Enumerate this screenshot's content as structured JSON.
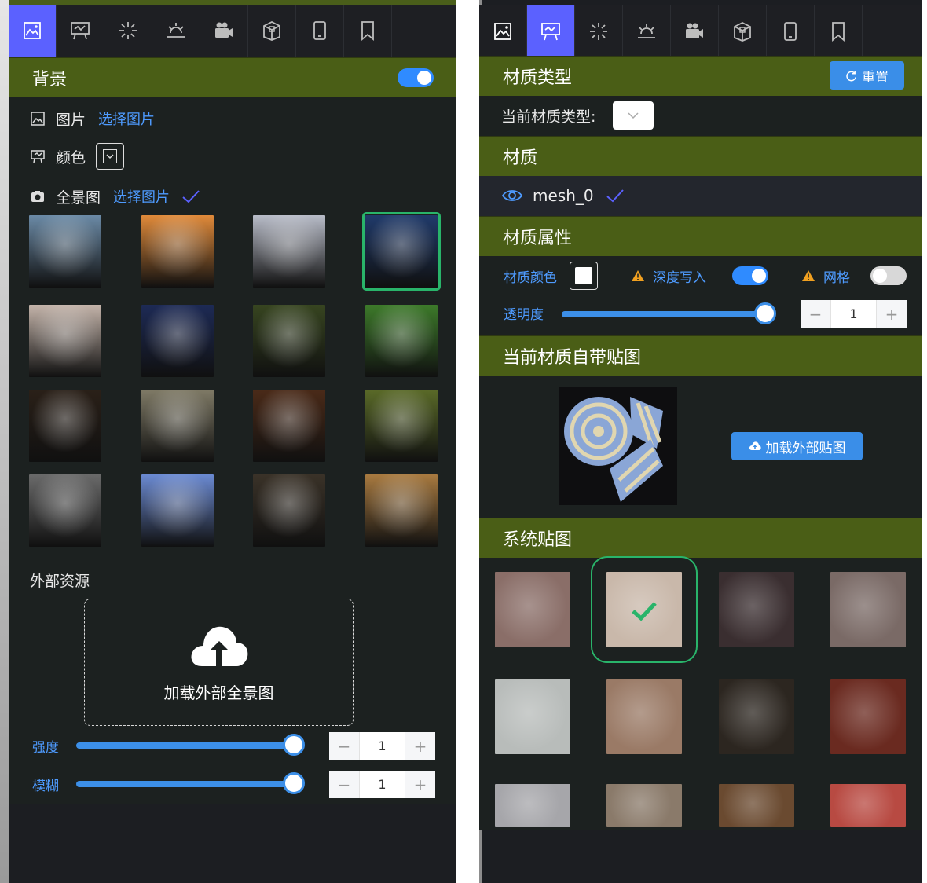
{
  "left_panel": {
    "tabs": [
      {
        "icon": "image-icon",
        "active": true
      },
      {
        "icon": "presentation-icon",
        "active": false
      },
      {
        "icon": "sparkle-icon",
        "active": false
      },
      {
        "icon": "sunrise-icon",
        "active": false
      },
      {
        "icon": "camera-icon",
        "active": false
      },
      {
        "icon": "box-icon",
        "active": false
      },
      {
        "icon": "tablet-icon",
        "active": false
      },
      {
        "icon": "bookmark-icon",
        "active": false
      }
    ],
    "section_title": "背景",
    "toggle_on": true,
    "image_label": "图片",
    "image_link": "选择图片",
    "color_label": "颜色",
    "panorama_label": "全景图",
    "panorama_link": "选择图片",
    "external_title": "外部资源",
    "upload_text": "加载外部全景图",
    "intensity_label": "强度",
    "intensity_value": "1",
    "blur_label": "模糊",
    "blur_value": "1",
    "thumbnails": [
      "#6b8aa6",
      "#e08a3a",
      "#b8bcc8",
      "#203a6a",
      "#c4b4aa",
      "#1d2a55",
      "#374520",
      "#3d7a2a",
      "#2a2018",
      "#7f7a66",
      "#4a2a18",
      "#5a6a28",
      "#6a6a6a",
      "#6b8ad2",
      "#3a3228",
      "#a87a40"
    ],
    "selected_index": 3
  },
  "right_panel": {
    "tabs": [
      {
        "icon": "image-icon",
        "active": false
      },
      {
        "icon": "presentation-icon",
        "active": true
      },
      {
        "icon": "sparkle-icon",
        "active": false
      },
      {
        "icon": "sunrise-icon",
        "active": false
      },
      {
        "icon": "camera-icon",
        "active": false
      },
      {
        "icon": "box-icon",
        "active": false
      },
      {
        "icon": "tablet-icon",
        "active": false
      },
      {
        "icon": "bookmark-icon",
        "active": false
      }
    ],
    "material_type_title": "材质类型",
    "reset_label": "重置",
    "current_type_label": "当前材质类型:",
    "material_title": "材质",
    "mesh_name": "mesh_0",
    "attr_title": "材质属性",
    "color_label": "材质颜色",
    "depth_label": "深度写入",
    "depth_on": true,
    "grid_label": "网格",
    "grid_on": false,
    "opacity_label": "透明度",
    "opacity_value": "1",
    "builtin_map_title": "当前材质自带贴图",
    "load_map_label": "加载外部贴图",
    "system_map_title": "系统贴图",
    "maps": [
      "#8a6e68",
      "#c9b8aa",
      "#3a2e30",
      "#7a6a66",
      "#b8bcba",
      "#9a7a66",
      "#2c2620",
      "#6a2a20",
      "#a6a6aa",
      "#8a7a6a",
      "#6a4a30",
      "#b84a42"
    ],
    "selected_map": 1
  }
}
